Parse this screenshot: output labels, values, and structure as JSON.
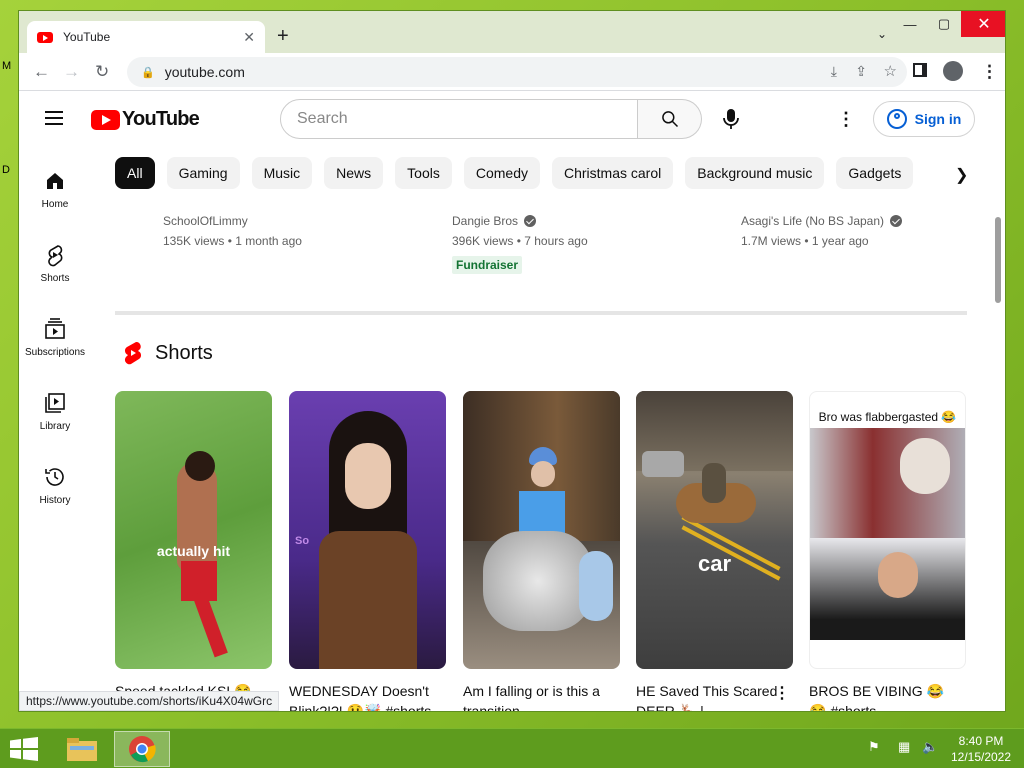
{
  "browser": {
    "tab_title": "YouTube",
    "url": "youtube.com",
    "status_url": "https://www.youtube.com/shorts/iKu4X04wGrc"
  },
  "youtube": {
    "logo_text": "YouTube",
    "search_placeholder": "Search",
    "sign_in": "Sign in",
    "sidebar": [
      {
        "label": "Home"
      },
      {
        "label": "Shorts"
      },
      {
        "label": "Subscriptions"
      },
      {
        "label": "Library"
      },
      {
        "label": "History"
      }
    ],
    "chips": [
      "All",
      "Gaming",
      "Music",
      "News",
      "Tools",
      "Comedy",
      "Christmas carol",
      "Background music",
      "Gadgets"
    ],
    "videos": [
      {
        "channel": "SchoolOfLimmy",
        "stats": "135K views • 1 month ago",
        "verified": false
      },
      {
        "channel": "Dangie Bros",
        "stats": "396K views • 7 hours ago",
        "verified": true,
        "badge": "Fundraiser"
      },
      {
        "channel": "Asagi's Life (No BS Japan)",
        "stats": "1.7M views • 1 year ago",
        "verified": true
      }
    ],
    "shorts_title": "Shorts",
    "shorts": [
      {
        "title": "Speed tackled KSI 😂",
        "caption": "actually hit"
      },
      {
        "title": "WEDNESDAY Doesn't Blink?!?! 😲🤯 #shorts",
        "caption": "So"
      },
      {
        "title": "Am I falling or is this a transition",
        "caption": ""
      },
      {
        "title": "HE Saved This Scared DEER 🦌 |",
        "caption": "car"
      },
      {
        "title": "BROS BE VIBING 😂 😂 #shorts",
        "caption": "Bro was flabbergasted 😂"
      }
    ]
  },
  "taskbar": {
    "time": "8:40 PM",
    "date": "12/15/2022"
  },
  "colors": {
    "youtube_red": "#ff0000",
    "link_blue": "#065fd4",
    "desktop_green": "#8cbf2a"
  }
}
